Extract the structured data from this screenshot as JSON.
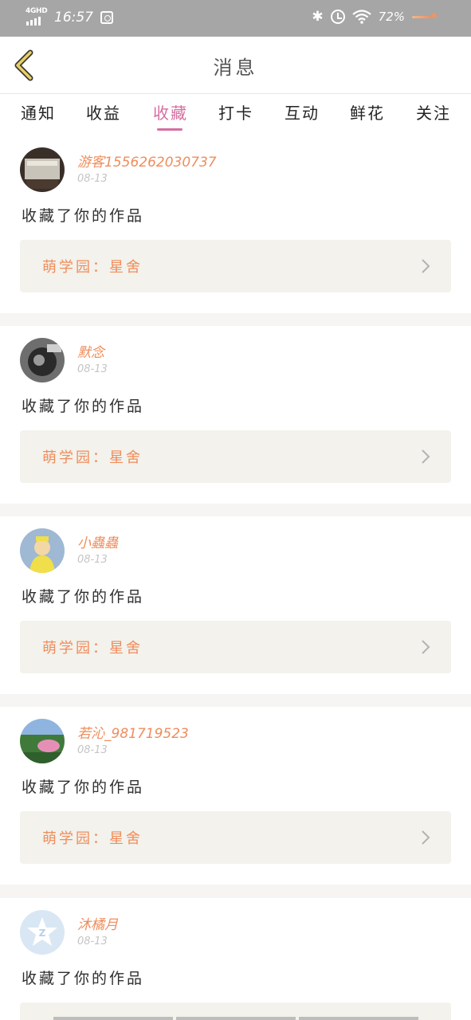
{
  "status_bar": {
    "network": "4GHD",
    "time": "16:57",
    "battery": "72%",
    "icons": [
      "signal-icon",
      "screenshot-icon",
      "bluetooth-icon",
      "alarm-icon",
      "wifi-icon",
      "charging-spark-icon"
    ]
  },
  "header": {
    "title": "消息",
    "back_icon": "chevron-left-icon"
  },
  "tabs": [
    {
      "label": "通知",
      "active": false
    },
    {
      "label": "收益",
      "active": false
    },
    {
      "label": "收藏",
      "active": true
    },
    {
      "label": "打卡",
      "active": false
    },
    {
      "label": "互动",
      "active": false
    },
    {
      "label": "鲜花",
      "active": false
    },
    {
      "label": "关注",
      "active": false
    }
  ],
  "messages": [
    {
      "username": "游客1556262030737",
      "date": "08-13",
      "action": "收藏了你的作品",
      "work_label": "萌学园：星舍",
      "avatar": "photo-avatar"
    },
    {
      "username": "默念",
      "date": "08-13",
      "action": "收藏了你的作品",
      "work_label": "萌学园：星舍",
      "avatar": "photo-avatar"
    },
    {
      "username": "小蟲蟲",
      "date": "08-13",
      "action": "收藏了你的作品",
      "work_label": "萌学园：星舍",
      "avatar": "photo-avatar"
    },
    {
      "username": "若沁_981719523",
      "date": "08-13",
      "action": "收藏了你的作品",
      "work_label": "萌学园：星舍",
      "avatar": "photo-avatar"
    },
    {
      "username": "沐橘月",
      "date": "08-13",
      "action": "收藏了你的作品",
      "work_label": "",
      "avatar": "default-avatar"
    }
  ],
  "colors": {
    "accent_pink": "#d56ea1",
    "accent_orange": "#ef8d5c",
    "status_bar": "#a6a6a6",
    "card_bg": "#f3f2ec"
  }
}
